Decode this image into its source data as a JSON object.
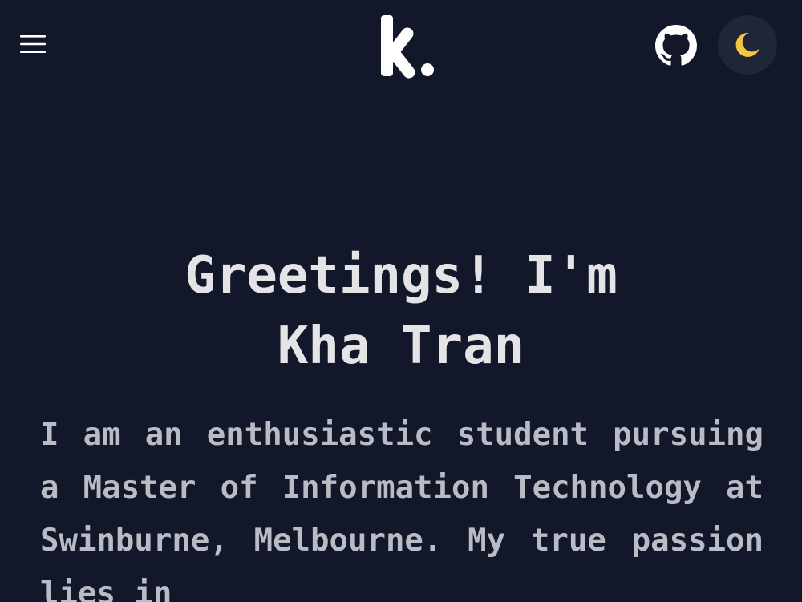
{
  "header": {
    "menu_icon": "hamburger-menu-icon",
    "logo_icon": "k-logo-icon",
    "github_icon": "github-icon",
    "theme_icon": "moon-icon"
  },
  "hero": {
    "title_line1": "Greetings! I'm",
    "title_line2": "Kha Tran",
    "intro": "I am an enthusiastic student pursuing a Master of Information Technology at Swinburne, Melbourne. My true passion lies in"
  },
  "colors": {
    "background": "#121829",
    "title": "#e4e4e7",
    "body_text": "#b9bcc4",
    "moon": "#f4c542",
    "toggle_bg": "#1f2736"
  }
}
